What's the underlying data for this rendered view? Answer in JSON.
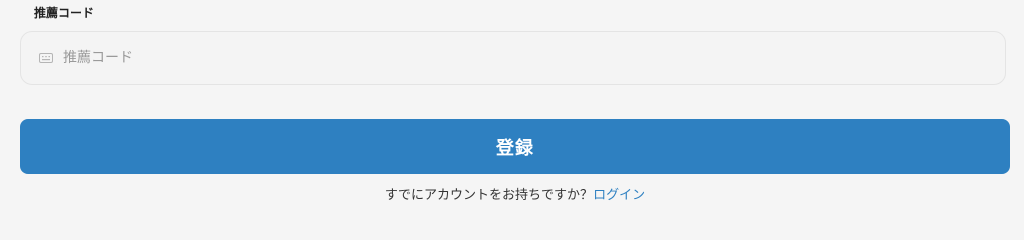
{
  "referral_code": {
    "label": "推薦コード",
    "placeholder": "推薦コード",
    "value": "",
    "icon": "keyboard-icon"
  },
  "submit": {
    "label": "登録",
    "color": "#2e80c1"
  },
  "login_prompt": {
    "text": "すでにアカウントをお持ちですか？",
    "link_label": "ログイン",
    "link_color": "#2e80c1"
  }
}
